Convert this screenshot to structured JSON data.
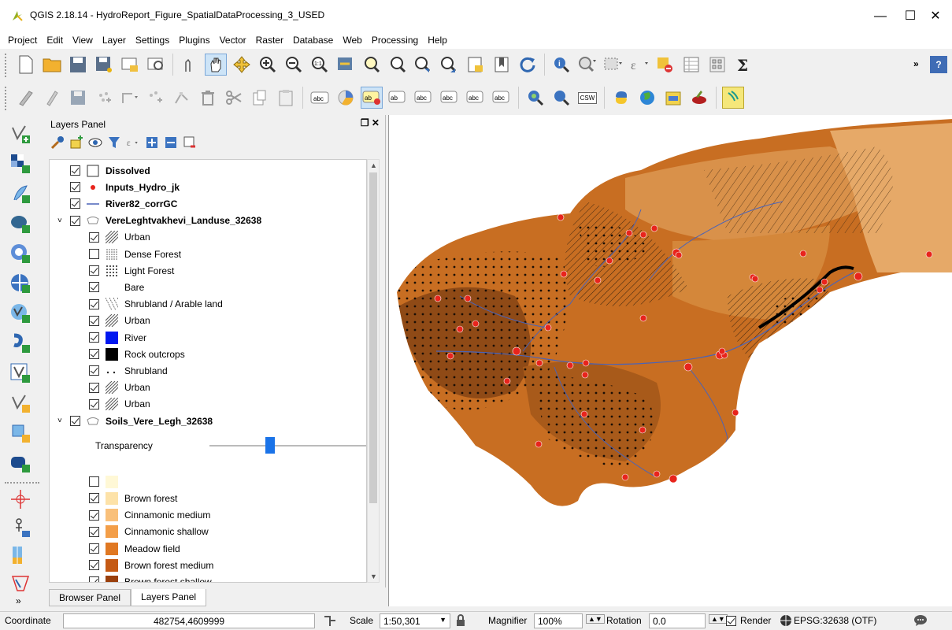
{
  "window": {
    "title": "QGIS 2.18.14 - HydroReport_Figure_SpatialDataProcessing_3_USED",
    "minimize": "—",
    "maximize": "☐",
    "close": "✕"
  },
  "menu": [
    "Project",
    "Edit",
    "View",
    "Layer",
    "Settings",
    "Plugins",
    "Vector",
    "Raster",
    "Database",
    "Web",
    "Processing",
    "Help"
  ],
  "toolbar": {
    "overflow": "»",
    "help": "?",
    "csw": "CSW",
    "abc": "abc"
  },
  "layers_panel": {
    "title": "Layers Panel",
    "controls": "❐ ✕",
    "items": [
      {
        "label": "Dissolved",
        "checked": true,
        "bold": true,
        "symbol": "empty-box"
      },
      {
        "label": "Inputs_Hydro_jk",
        "checked": true,
        "bold": true,
        "symbol": "red-dot"
      },
      {
        "label": "River82_corrGC",
        "checked": true,
        "bold": true,
        "symbol": "blue-line"
      },
      {
        "label": "VereLeghtvakhevi_Landuse_32638",
        "checked": true,
        "bold": true,
        "symbol": "polygon-group"
      },
      {
        "label": "Urban",
        "checked": true,
        "symbol": "hatch"
      },
      {
        "label": "Dense Forest",
        "checked": false,
        "symbol": "dense-dots"
      },
      {
        "label": "Light Forest",
        "checked": true,
        "symbol": "light-dots"
      },
      {
        "label": "Bare",
        "checked": true,
        "symbol": "white-box"
      },
      {
        "label": "Shrubland / Arable land",
        "checked": true,
        "symbol": "diag-hatch"
      },
      {
        "label": "Urban",
        "checked": true,
        "symbol": "hatch"
      },
      {
        "label": "River",
        "checked": true,
        "symbol": "blue-fill"
      },
      {
        "label": "Rock outcrops",
        "checked": true,
        "symbol": "black-fill"
      },
      {
        "label": "Shrubland",
        "checked": true,
        "symbol": "sparse-dots"
      },
      {
        "label": "Urban",
        "checked": true,
        "symbol": "hatch"
      },
      {
        "label": "Urban",
        "checked": true,
        "symbol": "hatch"
      },
      {
        "label": "Soils_Vere_Legh_32638",
        "checked": true,
        "bold": true,
        "symbol": "polygon-group"
      }
    ],
    "transparency_label": "Transparency",
    "transparency_value": 0.3,
    "soils": [
      {
        "label": "",
        "checked": false,
        "color": "#fff8d6"
      },
      {
        "label": "Brown forest",
        "checked": true,
        "color": "#fde2a8"
      },
      {
        "label": "Cinnamonic medium",
        "checked": true,
        "color": "#f9c07a"
      },
      {
        "label": "Cinnamonic shallow",
        "checked": true,
        "color": "#f39e48"
      },
      {
        "label": "Meadow field",
        "checked": true,
        "color": "#e07822"
      },
      {
        "label": "Brown forest medium",
        "checked": true,
        "color": "#c55a14"
      },
      {
        "label": "Brown forest shallow",
        "checked": true,
        "color": "#9a3f0c"
      }
    ]
  },
  "tabs": [
    "Browser Panel",
    "Layers Panel"
  ],
  "statusbar": {
    "coordinate_label": "Coordinate",
    "coordinate_value": "482754,4609999",
    "scale_label": "Scale",
    "scale_value": "1:50,301",
    "magnifier_label": "Magnifier",
    "magnifier_value": "100%",
    "rotation_label": "Rotation",
    "rotation_value": "0.0",
    "render_label": "Render",
    "crs": "EPSG:32638 (OTF)"
  }
}
